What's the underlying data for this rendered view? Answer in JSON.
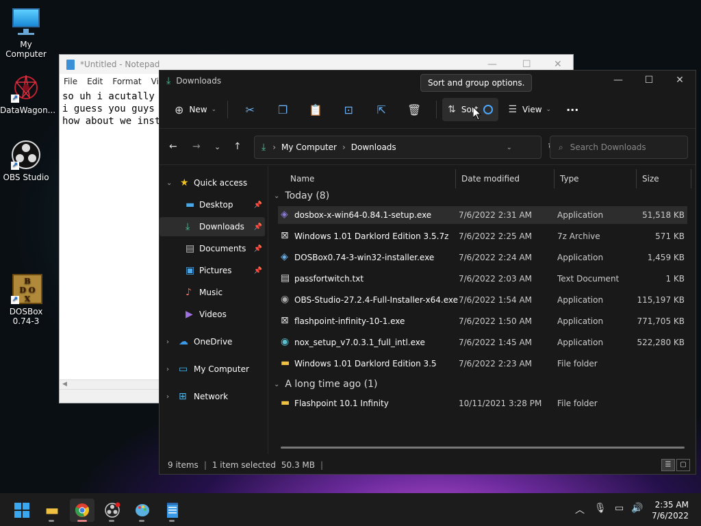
{
  "desktop": {
    "icons": [
      {
        "label": "My Computer",
        "icon": "monitor-icon"
      },
      {
        "label": "DataWagon...",
        "icon": "datawagon-icon"
      },
      {
        "label": "OBS Studio",
        "icon": "obs-icon"
      },
      {
        "label": "DOSBox 0.74-3",
        "icon": "dosbox-icon"
      }
    ]
  },
  "notepad": {
    "title": "*Untitled - Notepad",
    "menu": [
      "File",
      "Edit",
      "Format",
      "View"
    ],
    "lines": [
      "so uh i acutally d",
      "i guess you guys c",
      "how about we insta"
    ]
  },
  "explorer": {
    "title": "Downloads",
    "tooltip": "Sort and group options.",
    "toolbar": {
      "new_label": "New",
      "sort_label": "Sort",
      "view_label": "View",
      "more_label": "···"
    },
    "address": {
      "crumbs": [
        "My Computer",
        "Downloads"
      ]
    },
    "search": {
      "placeholder": "Search Downloads"
    },
    "nav": {
      "quick_access": "Quick access",
      "items": [
        {
          "label": "Desktop",
          "icon": "desktop-folder-icon",
          "pinned": true
        },
        {
          "label": "Downloads",
          "icon": "download-icon",
          "pinned": true,
          "selected": true
        },
        {
          "label": "Documents",
          "icon": "documents-icon",
          "pinned": true
        },
        {
          "label": "Pictures",
          "icon": "pictures-icon",
          "pinned": true
        },
        {
          "label": "Music",
          "icon": "music-icon",
          "pinned": false
        },
        {
          "label": "Videos",
          "icon": "videos-icon",
          "pinned": false
        }
      ],
      "roots": [
        "OneDrive",
        "My Computer",
        "Network"
      ]
    },
    "columns": {
      "name": "Name",
      "date": "Date modified",
      "type": "Type",
      "size": "Size"
    },
    "groups": [
      {
        "label": "Today (8)",
        "files": [
          {
            "name": "dosbox-x-win64-0.84.1-setup.exe",
            "date": "7/6/2022 2:31 AM",
            "type": "Application",
            "size": "51,518 KB",
            "icon": "installer-icon",
            "selected": true
          },
          {
            "name": "Windows 1.01 Darklord Edition 3.5.7z",
            "date": "7/6/2022 2:25 AM",
            "type": "7z Archive",
            "size": "571 KB",
            "icon": "archive-icon"
          },
          {
            "name": "DOSBox0.74-3-win32-installer.exe",
            "date": "7/6/2022 2:24 AM",
            "type": "Application",
            "size": "1,459 KB",
            "icon": "installer-icon"
          },
          {
            "name": "passfortwitch.txt",
            "date": "7/6/2022 2:03 AM",
            "type": "Text Document",
            "size": "1 KB",
            "icon": "text-file-icon"
          },
          {
            "name": "OBS-Studio-27.2.4-Full-Installer-x64.exe",
            "date": "7/6/2022 1:54 AM",
            "type": "Application",
            "size": "115,197 KB",
            "icon": "installer-icon"
          },
          {
            "name": "flashpoint-infinity-10-1.exe",
            "date": "7/6/2022 1:50 AM",
            "type": "Application",
            "size": "771,705 KB",
            "icon": "archive-icon"
          },
          {
            "name": "nox_setup_v7.0.3.1_full_intl.exe",
            "date": "7/6/2022 1:45 AM",
            "type": "Application",
            "size": "522,280 KB",
            "icon": "installer-icon"
          },
          {
            "name": "Windows 1.01 Darklord Edition 3.5",
            "date": "7/6/2022 2:23 AM",
            "type": "File folder",
            "size": "",
            "icon": "folder-icon"
          }
        ]
      },
      {
        "label": "A long time ago (1)",
        "files": [
          {
            "name": "Flashpoint 10.1 Infinity",
            "date": "10/11/2021 3:28 PM",
            "type": "File folder",
            "size": "",
            "icon": "folder-icon"
          }
        ]
      }
    ],
    "status": {
      "count": "9 items",
      "selection": "1 item selected",
      "size": "50.3 MB"
    }
  },
  "taskbar": {
    "clock_time": "2:35 AM",
    "clock_date": "7/6/2022"
  }
}
